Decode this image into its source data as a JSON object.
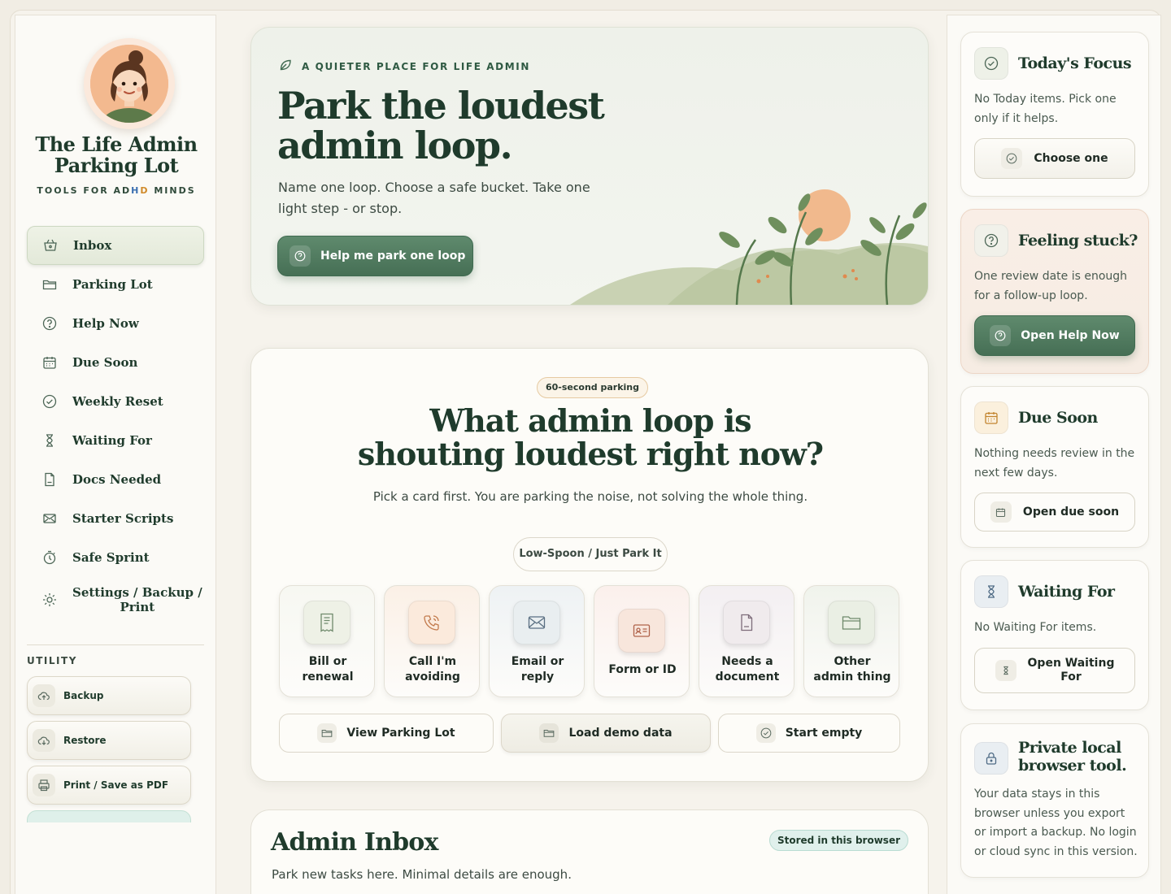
{
  "brand": {
    "title_line1": "The Life Admin",
    "title_line2": "Parking Lot",
    "sub_a": "TOOLS FOR AD",
    "sub_b": "H",
    "sub_c": "D",
    "sub_d": " MINDS"
  },
  "nav": [
    {
      "label": "Inbox",
      "icon": "basket-icon"
    },
    {
      "label": "Parking Lot",
      "icon": "folder-icon"
    },
    {
      "label": "Help Now",
      "icon": "question-icon"
    },
    {
      "label": "Due Soon",
      "icon": "calendar-icon"
    },
    {
      "label": "Weekly Reset",
      "icon": "check-circle-icon"
    },
    {
      "label": "Waiting For",
      "icon": "hourglass-icon"
    },
    {
      "label": "Docs Needed",
      "icon": "document-icon"
    },
    {
      "label": "Starter Scripts",
      "icon": "envelope-icon"
    },
    {
      "label": "Safe Sprint",
      "icon": "timer-icon"
    },
    {
      "label_line1": "Settings / Backup /",
      "label_line2": "Print",
      "icon": "sun-gear-icon"
    }
  ],
  "utility": {
    "label": "UTILITY",
    "buttons": [
      {
        "label": "Backup",
        "icon": "cloud-upload-icon"
      },
      {
        "label": "Restore",
        "icon": "cloud-download-icon"
      },
      {
        "label": "Print / Save as PDF",
        "icon": "printer-icon"
      }
    ]
  },
  "hero": {
    "eyebrow": "A QUIETER PLACE FOR LIFE ADMIN",
    "title_line1": "Park the loudest",
    "title_line2": "admin loop.",
    "lead": "Name one loop. Choose a safe bucket. Take one light step - or stop.",
    "cta": "Help me park one loop"
  },
  "parking": {
    "pill": "60-second parking",
    "title_line1": "What admin loop is",
    "title_line2": "shouting loudest right now?",
    "sub": "Pick a card first. You are parking the noise, not solving the whole thing.",
    "low_spoon": "Low-Spoon / Just Park It",
    "tiles": [
      {
        "line1": "Bill or",
        "line2": "renewal",
        "icon": "receipt-icon"
      },
      {
        "line1": "Call I'm",
        "line2": "avoiding",
        "icon": "phone-icon"
      },
      {
        "line1": "Email or",
        "line2": "reply",
        "icon": "envelope-icon"
      },
      {
        "line1": "Form or ID",
        "line2": "",
        "icon": "id-card-icon"
      },
      {
        "line1": "Needs a",
        "line2": "document",
        "icon": "document-icon"
      },
      {
        "line1": "Other",
        "line2": "admin thing",
        "icon": "folder-icon"
      }
    ],
    "actions": [
      {
        "label": "View Parking Lot",
        "icon": "folder-icon"
      },
      {
        "label": "Load demo data",
        "icon": "folder-icon"
      },
      {
        "label": "Start empty",
        "icon": "check-circle-icon"
      }
    ]
  },
  "inbox": {
    "title": "Admin Inbox",
    "badge": "Stored in this browser",
    "sub": "Park new tasks here. Minimal details are enough."
  },
  "rail": {
    "focus": {
      "title": "Today's Focus",
      "body": "No Today items. Pick one only if it helps.",
      "button": "Choose one"
    },
    "stuck": {
      "title": "Feeling stuck?",
      "body": "One review date is enough for a follow-up loop.",
      "button": "Open Help Now"
    },
    "due": {
      "title": "Due Soon",
      "body": "Nothing needs review in the next few days.",
      "button": "Open due soon"
    },
    "waiting": {
      "title": "Waiting For",
      "body": "No Waiting For items.",
      "button_line1": "Open Waiting",
      "button_line2": "For"
    },
    "private": {
      "title_line1": "Private local",
      "title_line2": "browser tool.",
      "body": "Your data stays in this browser unless you export or import a backup. No login or cloud sync in this version."
    }
  },
  "colors": {
    "brand_green": "#466f55",
    "ink": "#1f3b2c",
    "peach": "#f3b98f",
    "background": "#f1ede4"
  }
}
